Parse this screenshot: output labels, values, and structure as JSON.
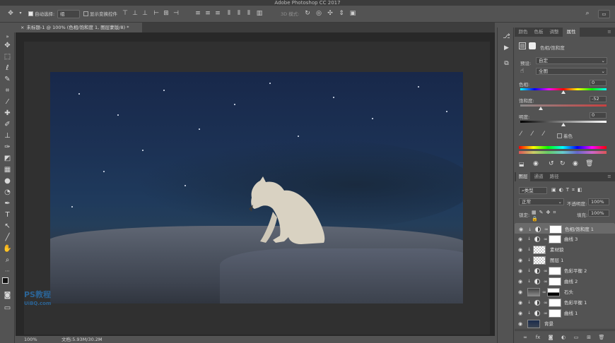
{
  "app": {
    "title": "Adobe Photoshop CC 2017"
  },
  "options": {
    "auto_select_label": "自动选择:",
    "auto_select_value": "组",
    "show_transform_label": "显示变换控件",
    "mode_3d_label": "3D 模式:"
  },
  "document": {
    "tab_title": "未标题-1 @ 100% (色相/饱和度 1, 图层蒙版/8) *",
    "zoom": "100%",
    "file_info": "文档:5.93M/30.2M"
  },
  "watermark": {
    "line1": "PS教程",
    "line2": "UiBQ.com"
  },
  "properties": {
    "tabs": [
      "颜色",
      "色板",
      "调整",
      "属性"
    ],
    "active_tab": "属性",
    "adjustment_title": "色相/饱和度",
    "preset_label": "预设:",
    "preset_value": "自定",
    "channel_value": "全图",
    "hue_label": "色相:",
    "hue_value": "0",
    "hue_level": 0.5,
    "saturation_label": "饱和度:",
    "saturation_value": "-52",
    "saturation_level": 0.24,
    "lightness_label": "明度:",
    "lightness_value": "0",
    "lightness_level": 0.5,
    "colorize_label": "着色"
  },
  "layers_panel": {
    "tabs": [
      "图层",
      "通道",
      "路径"
    ],
    "active_tab": "图层",
    "filter_label": "类型",
    "blend_mode": "正常",
    "opacity_label": "不透明度:",
    "opacity_value": "100%",
    "lock_label": "锁定:",
    "fill_label": "填充:",
    "fill_value": "100%",
    "layers": [
      {
        "name": "色相/饱和度 1",
        "type": "adjustment",
        "selected": true
      },
      {
        "name": "曲线 3",
        "type": "adjustment",
        "selected": false
      },
      {
        "name": "素材狼",
        "type": "image",
        "selected": false
      },
      {
        "name": "图层 1",
        "type": "image",
        "selected": false
      },
      {
        "name": "色彩平衡 2",
        "type": "adjustment",
        "selected": false
      },
      {
        "name": "曲线 2",
        "type": "adjustment",
        "selected": false
      },
      {
        "name": "石头",
        "type": "image-mask",
        "selected": false
      },
      {
        "name": "色彩平衡 1",
        "type": "adjustment",
        "selected": false
      },
      {
        "name": "曲线 1",
        "type": "adjustment",
        "selected": false
      },
      {
        "name": "背景",
        "type": "background",
        "selected": false
      }
    ]
  },
  "colors": {
    "accent": "#2a76b8",
    "panel": "#535353",
    "canvas": "#282828"
  }
}
